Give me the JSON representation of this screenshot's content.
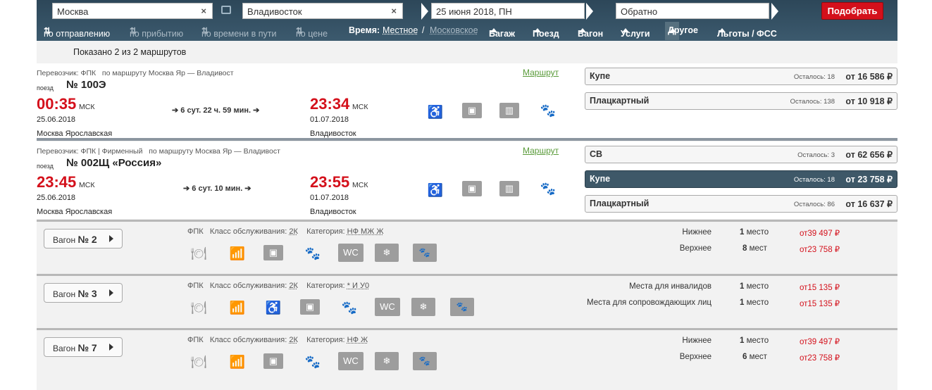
{
  "search": {
    "from": "Москва",
    "to": "Владивосток",
    "date": "25 июня 2018, ПН",
    "return_placeholder": "Обратно",
    "submit": "Подобрать"
  },
  "sort": {
    "by_departure": "по отправлению",
    "by_arrival": "по прибытию",
    "by_duration": "по времени в пути",
    "by_price": "по цене",
    "time_label": "Время:",
    "time_local": "Местное",
    "time_sep": "/",
    "time_moscow": "Московское",
    "filters": [
      "Багаж",
      "Поезд",
      "Вагон",
      "Услуги",
      "Другое",
      "Льготы / ФСС"
    ]
  },
  "shown": "Показано 2 из 2 маршрутов",
  "route_link": "Маршрут",
  "train_word": "поезд",
  "msk": "МСК",
  "trains": [
    {
      "carrier": "Перевозчик: ФПК",
      "route": "по маршруту Москва Яр — Владивост",
      "number": "№ 100Э",
      "dep_time": "00:35",
      "dep_date": "25.06.2018",
      "dep_station": "Москва Ярославская",
      "duration": "6 сут. 22 ч. 59 мин.",
      "arr_time": "23:34",
      "arr_date": "01.07.2018",
      "arr_station": "Владивосток",
      "classes": [
        {
          "name": "Купе",
          "left": "Осталось: 18",
          "price": "от 16 586 ₽"
        },
        {
          "name": "Плацкартный",
          "left": "Осталось: 138",
          "price": "от 10 918 ₽"
        }
      ]
    },
    {
      "carrier": "Перевозчик: ФПК | Фирменный",
      "route": "по маршруту Москва Яр — Владивост",
      "number": "№ 002Щ «Россия»",
      "dep_time": "23:45",
      "dep_date": "25.06.2018",
      "dep_station": "Москва Ярославская",
      "duration": "6 сут. 10 мин.",
      "arr_time": "23:55",
      "arr_date": "01.07.2018",
      "arr_station": "Владивосток",
      "classes": [
        {
          "name": "СВ",
          "left": "Осталось: 3",
          "price": "от 62 656 ₽"
        },
        {
          "name": "Купе",
          "left": "Осталось: 18",
          "price": "от 23 758 ₽"
        },
        {
          "name": "Плацкартный",
          "left": "Осталось: 86",
          "price": "от 16 637 ₽"
        }
      ]
    }
  ],
  "wagons": [
    {
      "label": "Вагон",
      "number": "№ 2",
      "carrier": "ФПК",
      "service_label": "Класс обслуживания:",
      "service": "2К",
      "category_label": "Категория:",
      "category": "НФ МЖ Ж",
      "seats": [
        {
          "type": "Нижнее",
          "count": "1",
          "unit": "место",
          "price": "от39 497 ₽"
        },
        {
          "type": "Верхнее",
          "count": "8",
          "unit": "мест",
          "price": "от23 758 ₽"
        }
      ]
    },
    {
      "label": "Вагон",
      "number": "№ 3",
      "carrier": "ФПК",
      "service_label": "Класс обслуживания:",
      "service": "2К",
      "category_label": "Категория:",
      "category": "* И У0",
      "seats": [
        {
          "type": "Места для инвалидов",
          "count": "1",
          "unit": "место",
          "price": "от15 135 ₽"
        },
        {
          "type": "Места для сопровождающих лиц",
          "count": "1",
          "unit": "место",
          "price": "от15 135 ₽"
        }
      ]
    },
    {
      "label": "Вагон",
      "number": "№ 7",
      "carrier": "ФПК",
      "service_label": "Класс обслуживания:",
      "service": "2К",
      "category_label": "Категория:",
      "category": "НФ Ж",
      "seats": [
        {
          "type": "Нижнее",
          "count": "1",
          "unit": "место",
          "price": "от39 497 ₽"
        },
        {
          "type": "Верхнее",
          "count": "6",
          "unit": "мест",
          "price": "от23 758 ₽"
        }
      ]
    }
  ],
  "colors": {
    "accent_red": "#d4101b",
    "header": "#2d4759",
    "link_green": "#5a9b3a"
  }
}
